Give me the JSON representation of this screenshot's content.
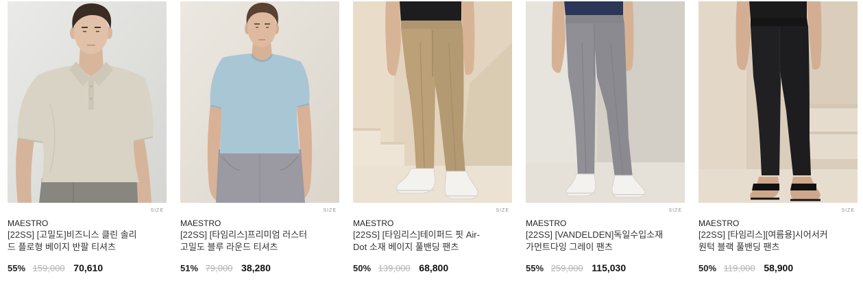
{
  "products": [
    {
      "size_label": "SIZE",
      "brand": "MAESTRO",
      "name_lines": [
        "[22SS] [고밀도]비즈니스 클린 솔리",
        "드 플로형 베이지 반팔 티셔츠"
      ],
      "discount": "55%",
      "original_price": "159,000",
      "sale_price": "70,610"
    },
    {
      "size_label": "SIZE",
      "brand": "MAESTRO",
      "name_lines": [
        "[22SS] [타임리스]프리미엄 러스터",
        "고밀도 블루 라운드 티셔츠"
      ],
      "discount": "51%",
      "original_price": "79,000",
      "sale_price": "38,280"
    },
    {
      "size_label": "SIZE",
      "brand": "MAESTRO",
      "name_lines": [
        "[22SS] [타임리스]테이퍼드 핏 Air-",
        "Dot 소재 베이지 풀밴딩 팬츠"
      ],
      "discount": "50%",
      "original_price": "139,000",
      "sale_price": "68,800"
    },
    {
      "size_label": "SIZE",
      "brand": "MAESTRO",
      "name_lines": [
        "[22SS] [VANDELDEN]독일수입소재",
        "가먼트다잉 그레이 팬츠"
      ],
      "discount": "55%",
      "original_price": "259,000",
      "sale_price": "115,030"
    },
    {
      "size_label": "SIZE",
      "brand": "MAESTRO",
      "name_lines": [
        "[22SS] [타임리스][여름용]시어서커",
        "원턱 블랙 풀밴딩 팬츠"
      ],
      "discount": "50%",
      "original_price": "119,000",
      "sale_price": "58,900"
    }
  ]
}
